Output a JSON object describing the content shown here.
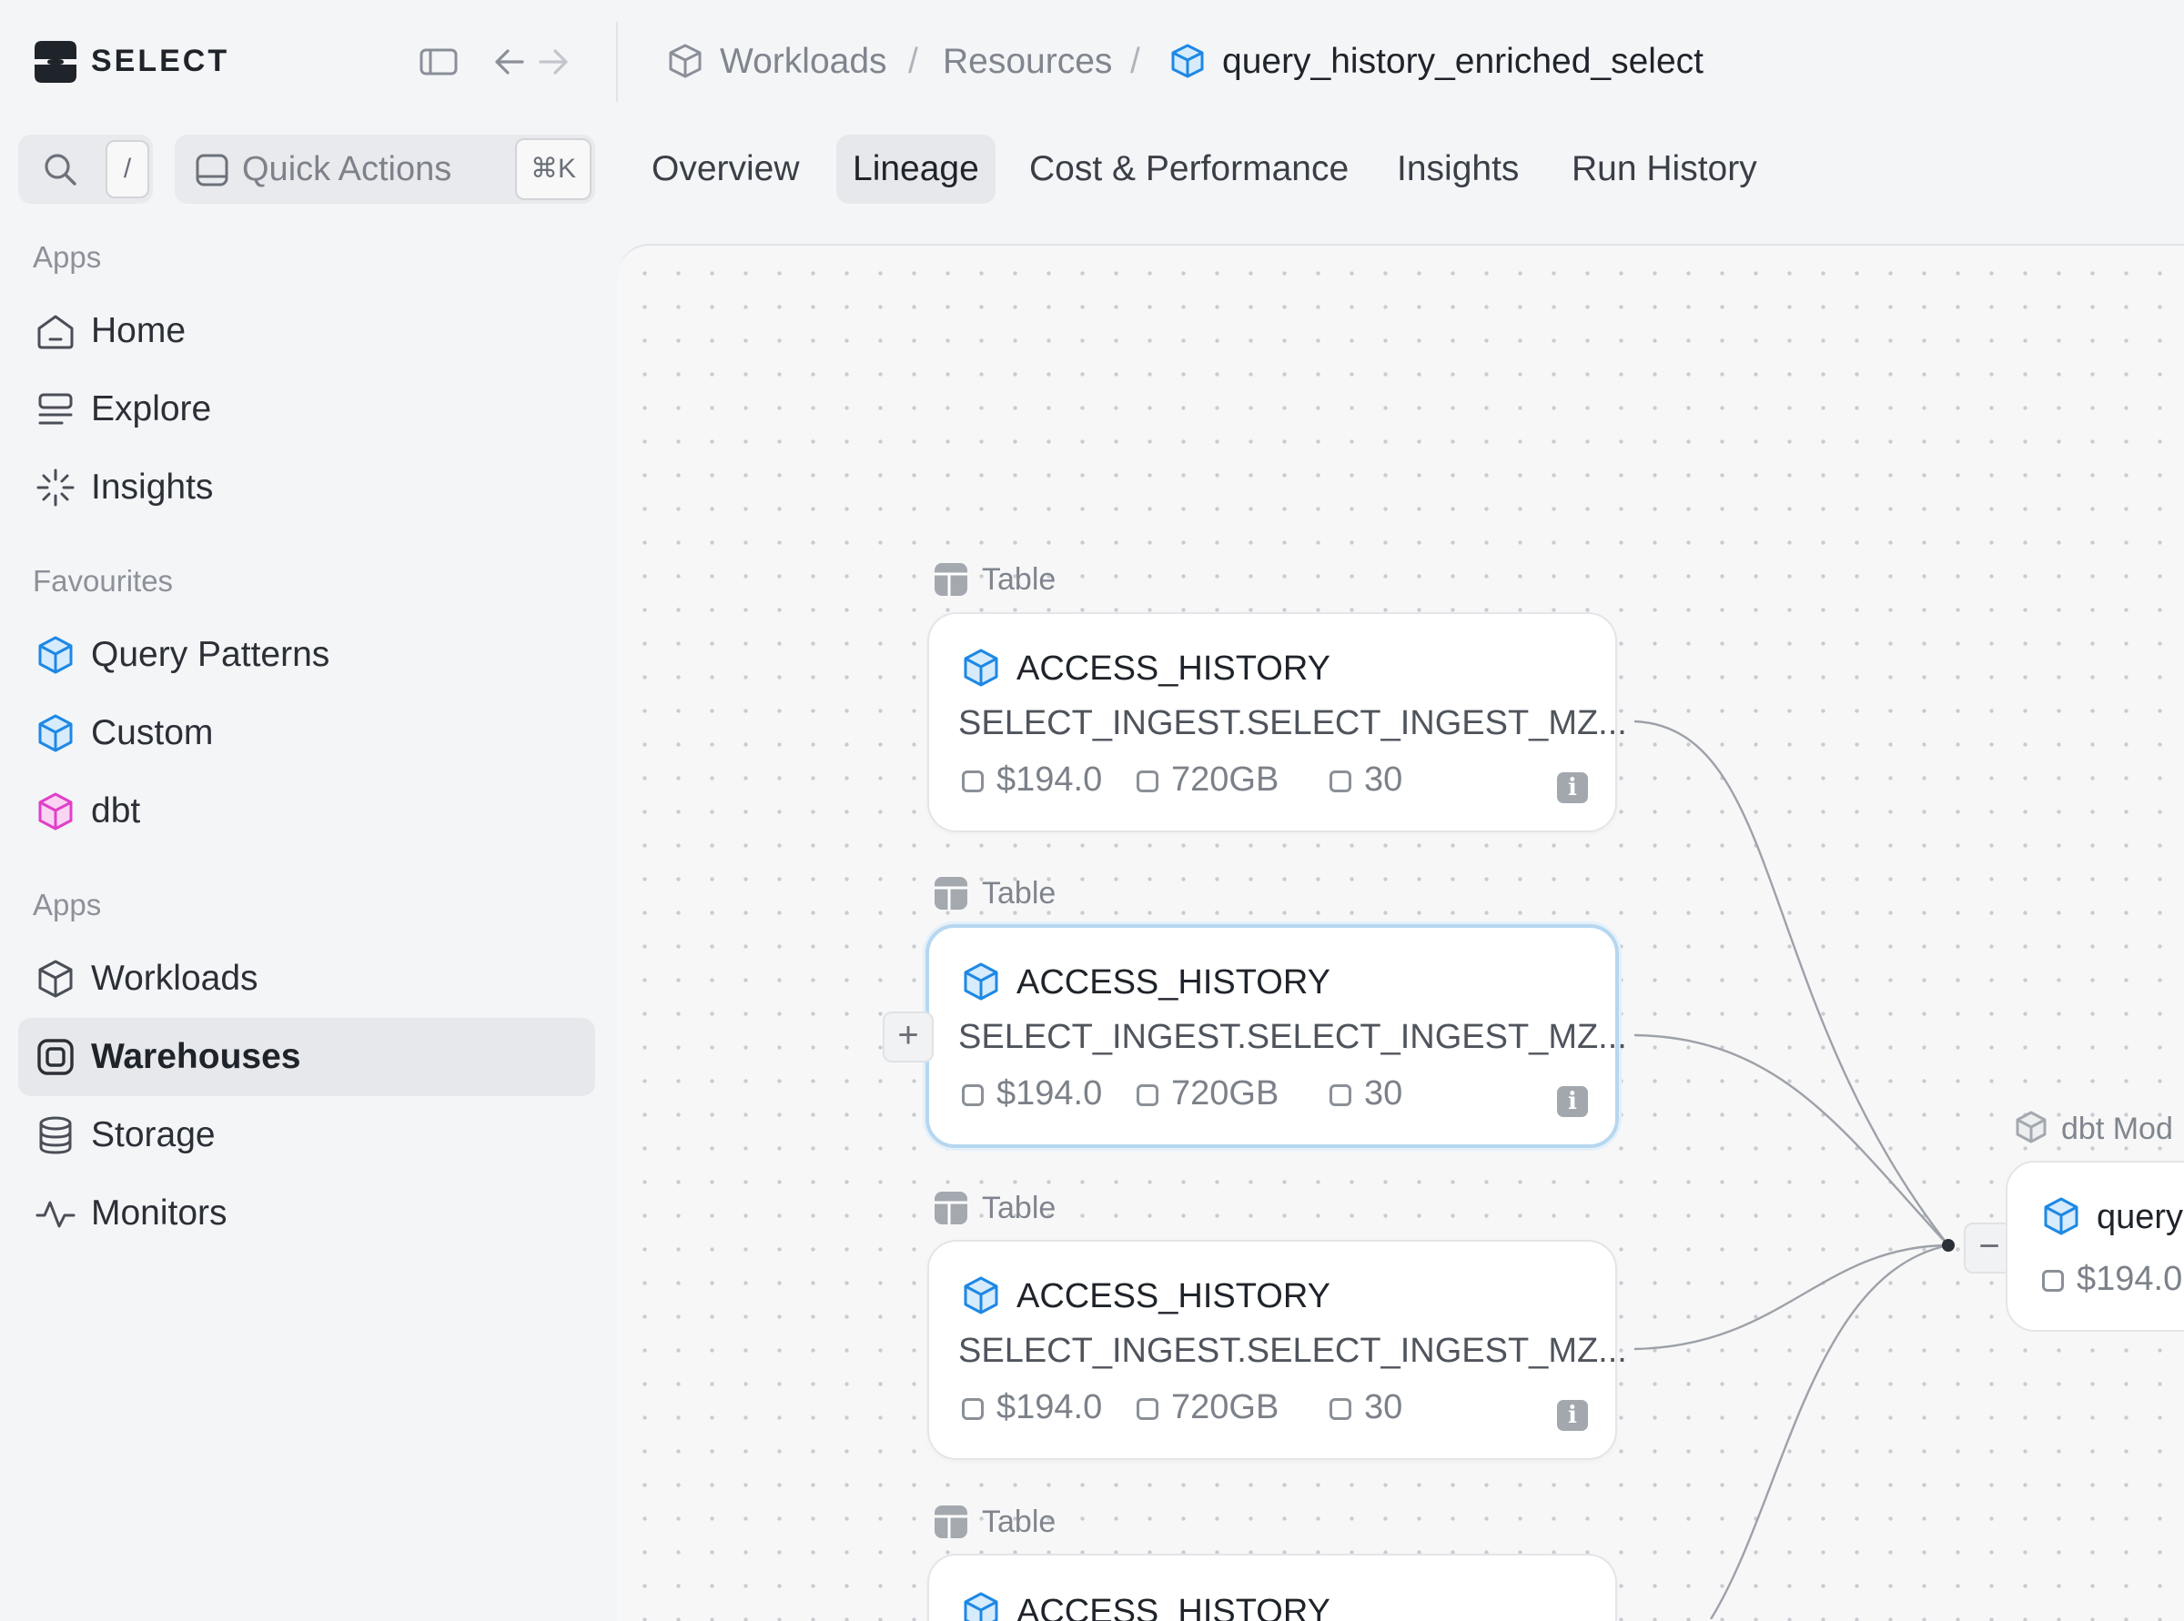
{
  "app": {
    "name": "SELECT"
  },
  "search": {
    "shortcut": "/"
  },
  "quick_actions": {
    "label": "Quick Actions",
    "shortcut": "⌘K"
  },
  "sidebar": {
    "sections": [
      {
        "title": "Apps",
        "items": [
          {
            "label": "Home",
            "icon": "home-icon"
          },
          {
            "label": "Explore",
            "icon": "explore-icon"
          },
          {
            "label": "Insights",
            "icon": "sparkle-icon"
          }
        ]
      },
      {
        "title": "Favourites",
        "items": [
          {
            "label": "Query Patterns",
            "icon": "cube-icon",
            "color": "#1e88e5"
          },
          {
            "label": "Custom",
            "icon": "cube-icon",
            "color": "#1e88e5"
          },
          {
            "label": "dbt",
            "icon": "cube-icon",
            "color": "#e040c8"
          }
        ]
      },
      {
        "title": "Apps",
        "items": [
          {
            "label": "Workloads",
            "icon": "cube-outline-icon"
          },
          {
            "label": "Warehouses",
            "icon": "warehouse-icon",
            "active": true
          },
          {
            "label": "Storage",
            "icon": "database-icon"
          },
          {
            "label": "Monitors",
            "icon": "pulse-icon"
          }
        ]
      }
    ]
  },
  "breadcrumb": {
    "items": [
      "Workloads",
      "Resources",
      "query_history_enriched_select"
    ],
    "separator": "/"
  },
  "tabs": [
    {
      "label": "Overview"
    },
    {
      "label": "Lineage",
      "active": true
    },
    {
      "label": "Cost & Performance"
    },
    {
      "label": "Insights"
    },
    {
      "label": "Run History"
    }
  ],
  "lineage": {
    "nodes": [
      {
        "type": "Table",
        "title": "ACCESS_HISTORY",
        "subtitle": "SELECT_INGEST.SELECT_INGEST_MZ...",
        "cost": "$194.0",
        "size": "720GB",
        "count": "30",
        "selected": false
      },
      {
        "type": "Table",
        "title": "ACCESS_HISTORY",
        "subtitle": "SELECT_INGEST.SELECT_INGEST_MZ...",
        "cost": "$194.0",
        "size": "720GB",
        "count": "30",
        "selected": true
      },
      {
        "type": "Table",
        "title": "ACCESS_HISTORY",
        "subtitle": "SELECT_INGEST.SELECT_INGEST_MZ...",
        "cost": "$194.0",
        "size": "720GB",
        "count": "30",
        "selected": false
      },
      {
        "type": "Table",
        "title": "ACCESS_HISTORY"
      }
    ],
    "target": {
      "type": "dbt Mod",
      "title": "query",
      "cost": "$194.0"
    },
    "expand_label": "+",
    "collapse_label": "−",
    "info_label": "i"
  },
  "colors": {
    "accent_blue": "#1e88e5",
    "dbt_pink": "#e040c8",
    "selected_border": "#b6d7f0"
  }
}
